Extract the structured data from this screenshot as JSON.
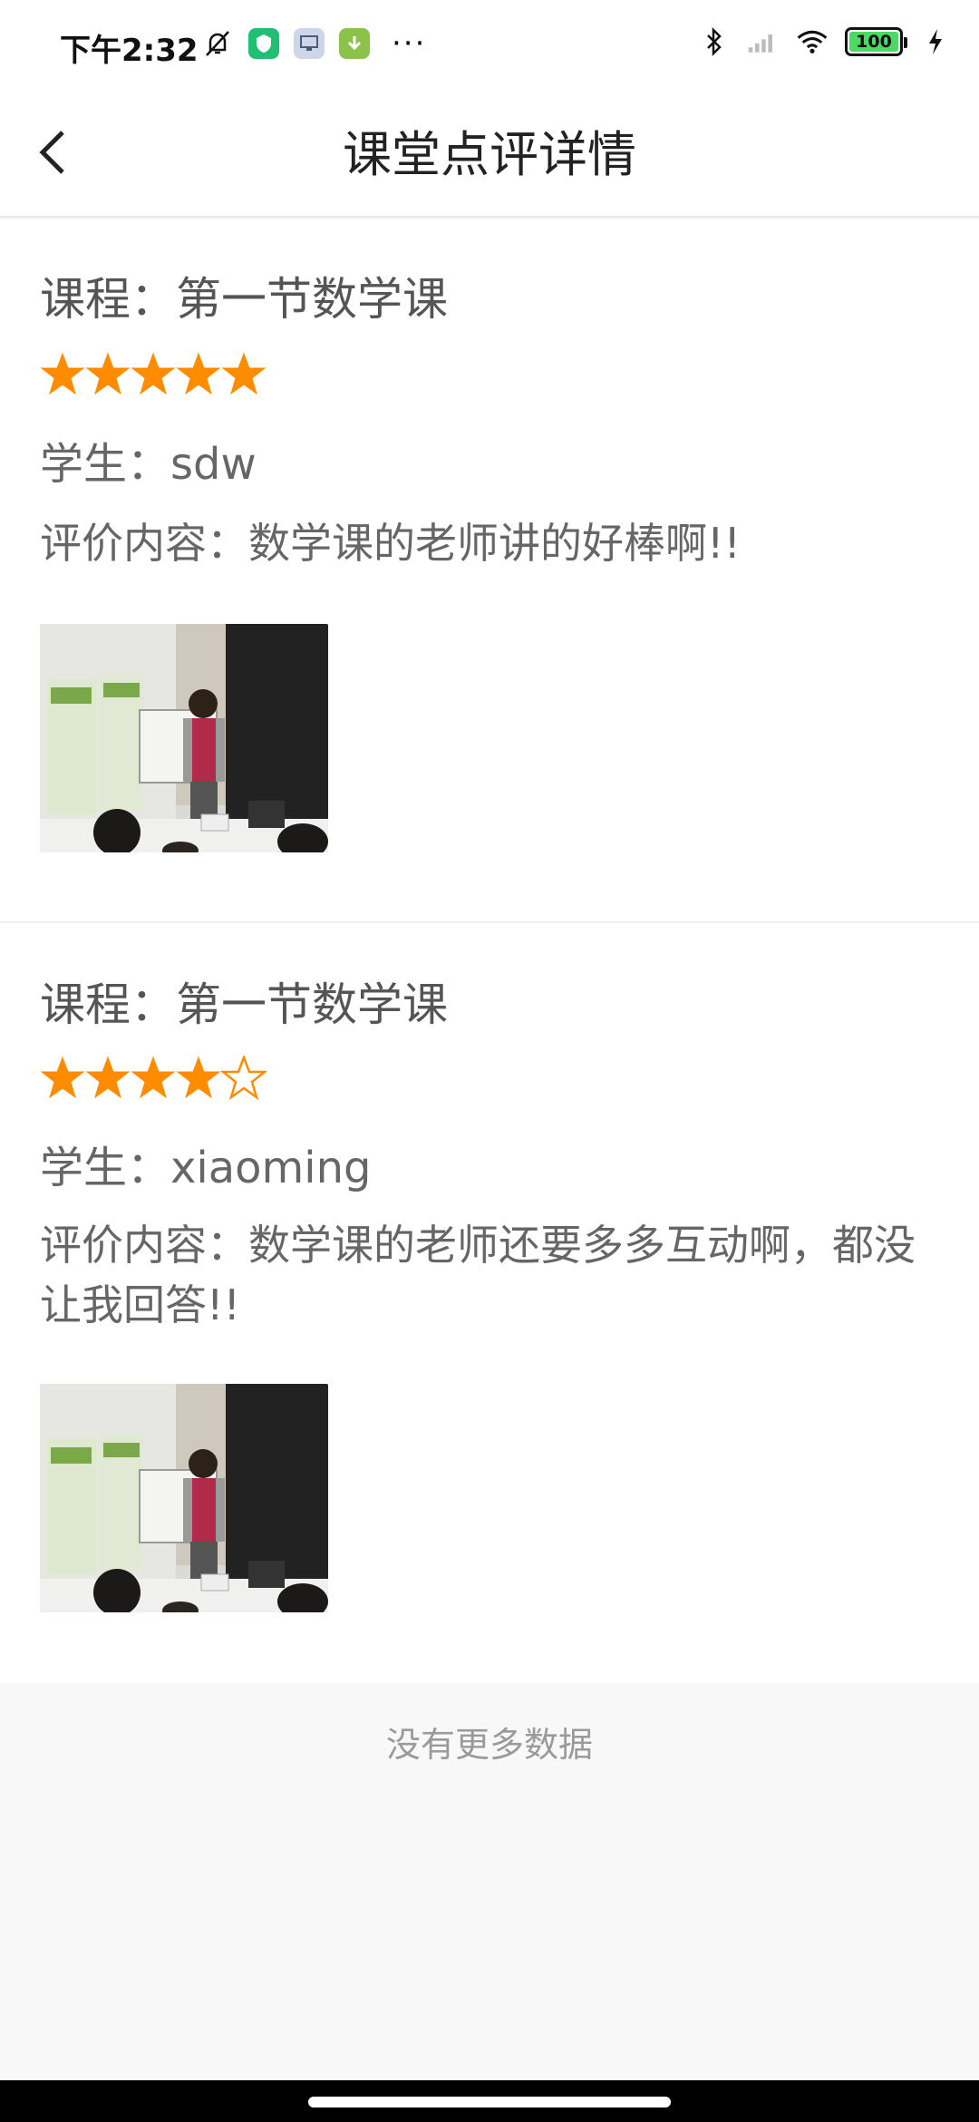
{
  "status_bar": {
    "time": "下午2:32",
    "icons": [
      "mute-bell-icon",
      "shield-app-icon",
      "screen-app-icon",
      "download-app-icon",
      "more-dots-icon"
    ],
    "right_icons": [
      "bluetooth-icon",
      "signal-icon",
      "wifi-icon",
      "battery-icon",
      "charging-icon"
    ],
    "battery_level": "100",
    "more": "···"
  },
  "header": {
    "title": "课堂点评详情",
    "back_icon": "chevron-left-icon"
  },
  "reviews": [
    {
      "course": "课程：第一节数学课",
      "rating": 5,
      "max_rating": 5,
      "student": "学生：sdw",
      "comment": "评价内容：数学课的老师讲的好棒啊!!",
      "photo_icon": "classroom-photo"
    },
    {
      "course": "课程：第一节数学课",
      "rating": 4,
      "max_rating": 5,
      "student": "学生：xiaoming",
      "comment": "评价内容：数学课的老师还要多多互动啊，都没让我回答!!",
      "photo_icon": "classroom-photo"
    }
  ],
  "footer": {
    "text": "没有更多数据"
  },
  "colors": {
    "star": "#ff8c00",
    "accent_green": "#4cd964"
  }
}
